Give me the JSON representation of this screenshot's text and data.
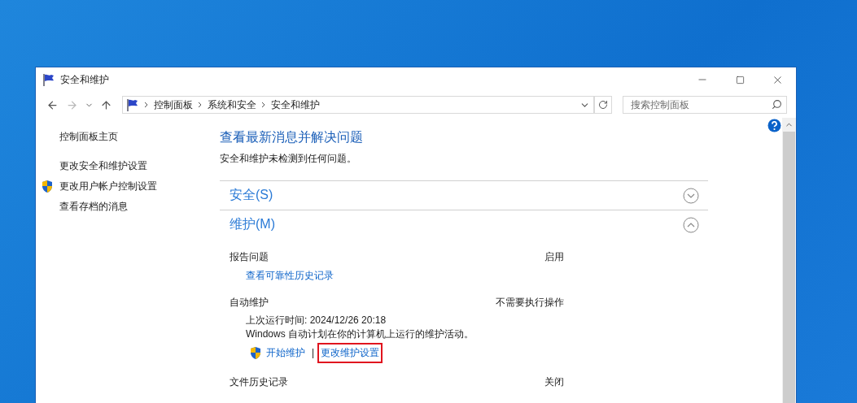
{
  "window": {
    "title": "安全和维护"
  },
  "address_bar": {
    "breadcrumbs": [
      "控制面板",
      "系统和安全",
      "安全和维护"
    ]
  },
  "search": {
    "placeholder": "搜索控制面板"
  },
  "sidebar": {
    "items": [
      {
        "label": "控制面板主页",
        "kind": "home"
      },
      {
        "label": "更改安全和维护设置",
        "kind": "link"
      },
      {
        "label": "更改用户帐户控制设置",
        "kind": "shield-link"
      },
      {
        "label": "查看存档的消息",
        "kind": "link"
      }
    ]
  },
  "main": {
    "heading": "查看最新消息并解决问题",
    "summary": "安全和维护未检测到任何问题。",
    "sections": [
      {
        "title": "安全(S)",
        "expanded": false
      },
      {
        "title": "维护(M)",
        "expanded": true,
        "items": [
          {
            "kind": "status",
            "label": "报告问题",
            "value": "启用"
          },
          {
            "kind": "link",
            "label": "查看可靠性历史记录"
          },
          {
            "kind": "status",
            "label": "自动维护",
            "value": "不需要执行操作"
          },
          {
            "kind": "text",
            "lines": [
              "上次运行时间: 2024/12/26 20:18",
              "Windows 自动计划在你的计算机上运行的维护活动。"
            ]
          },
          {
            "kind": "actions",
            "separator": "|",
            "actions": [
              {
                "label": "开始维护",
                "shield": true,
                "highlighted": false
              },
              {
                "label": "更改维护设置",
                "shield": false,
                "highlighted": true
              }
            ]
          },
          {
            "kind": "status",
            "label": "文件历史记录",
            "value": "关闭"
          }
        ]
      }
    ]
  }
}
